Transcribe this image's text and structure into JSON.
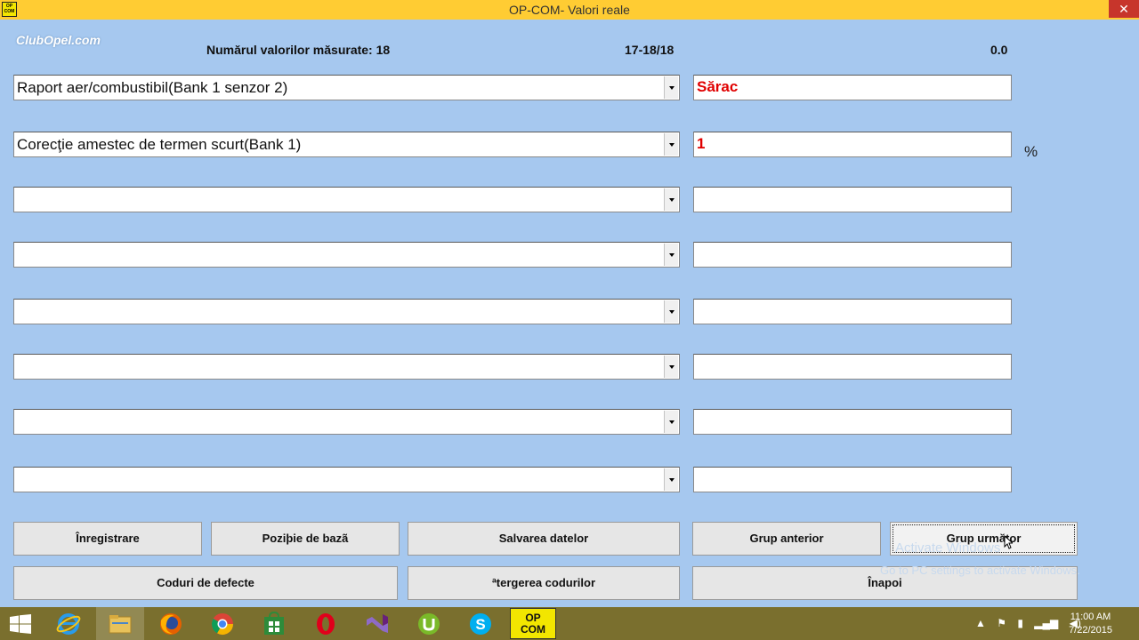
{
  "window": {
    "title": "OP-COM- Valori reale",
    "app_icon": "OP\nCOM",
    "close_glyph": "✕"
  },
  "logo": "ClubOpel.com",
  "header": {
    "count_label": "Numărul valorilor măsurate: 18",
    "range": "17-18/18",
    "value": "0.0"
  },
  "rows": [
    {
      "param": "Raport aer/combustibil(Bank 1 senzor 2)",
      "value": "Sărac",
      "unit": ""
    },
    {
      "param": "Corecţie amestec de termen scurt(Bank 1)",
      "value": "1",
      "unit": "%"
    },
    {
      "param": "",
      "value": "",
      "unit": ""
    },
    {
      "param": "",
      "value": "",
      "unit": ""
    },
    {
      "param": "",
      "value": "",
      "unit": ""
    },
    {
      "param": "",
      "value": "",
      "unit": ""
    },
    {
      "param": "",
      "value": "",
      "unit": ""
    },
    {
      "param": "",
      "value": "",
      "unit": ""
    }
  ],
  "buttons": {
    "record": "Înregistrare",
    "base_position": "Poziþie de bazã",
    "save_data": "Salvarea datelor",
    "prev_group": "Grup anterior",
    "next_group": "Grup următor",
    "fault_codes": "Coduri de defecte",
    "clear_codes": "ªtergerea codurilor",
    "back": "Înapoi"
  },
  "activation_notice": {
    "title": "Activate Windows",
    "subtitle": "Go to PC settings to activate Windows."
  },
  "taskbar": {
    "apps": [
      "internet-explorer-icon",
      "file-explorer-icon",
      "firefox-icon",
      "chrome-icon",
      "store-icon",
      "opera-icon",
      "visual-studio-icon",
      "utorrent-icon",
      "skype-icon"
    ],
    "opcom_label": "OP\nCOM",
    "clock_time": "11:00 AM",
    "clock_date": "7/22/2015"
  },
  "colors": {
    "background": "#a6c8ef",
    "titlebar": "#ffcc33",
    "value_text": "#e00000",
    "taskbar": "#7a6f2e"
  }
}
